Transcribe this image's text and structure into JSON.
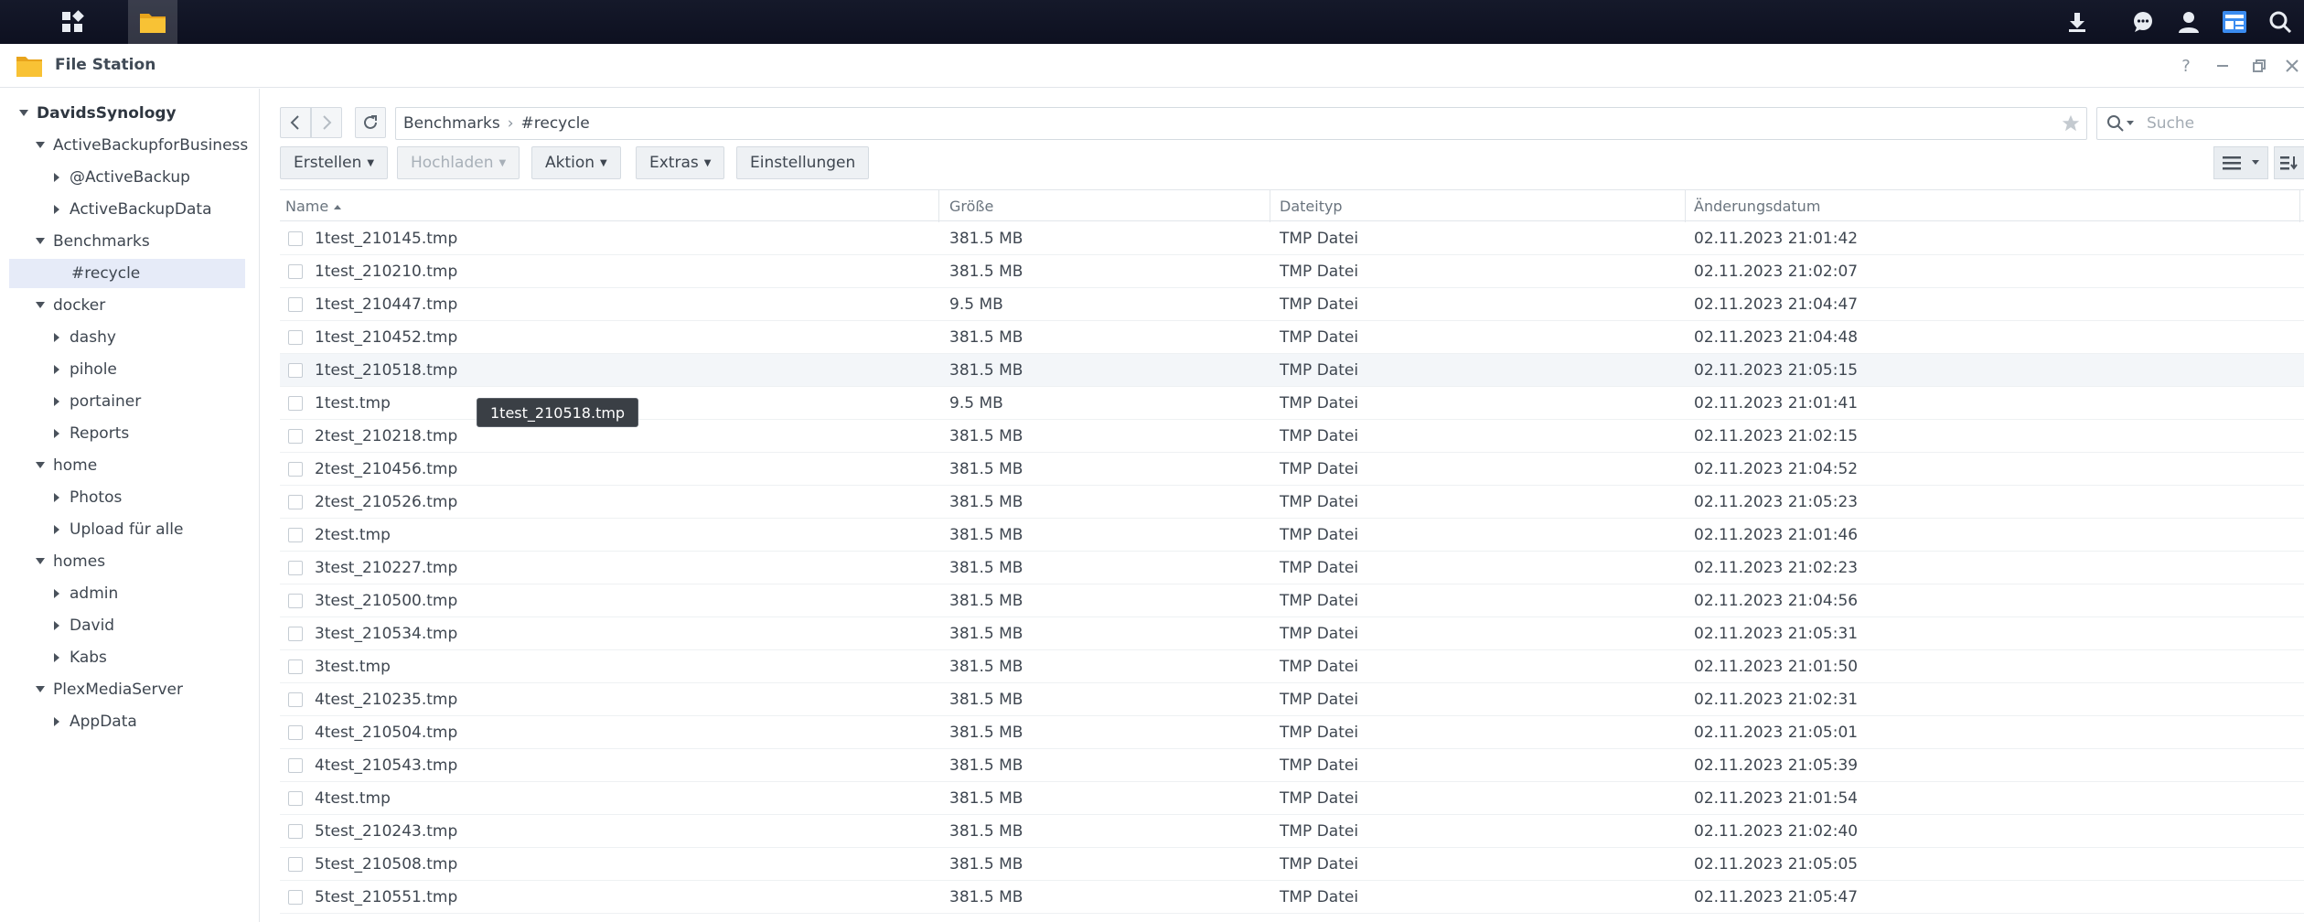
{
  "window": {
    "title": "File Station"
  },
  "sidebar": {
    "root": "DavidsSynology",
    "items": [
      {
        "label": "ActiveBackupforBusiness",
        "level": 1,
        "expanded": true
      },
      {
        "label": "@ActiveBackup",
        "level": 2,
        "expanded": false
      },
      {
        "label": "ActiveBackupData",
        "level": 2,
        "expanded": false
      },
      {
        "label": "Benchmarks",
        "level": 1,
        "expanded": true
      },
      {
        "label": "#recycle",
        "level": 2,
        "selected": true
      },
      {
        "label": "docker",
        "level": 1,
        "expanded": true
      },
      {
        "label": "dashy",
        "level": 2,
        "expanded": false
      },
      {
        "label": "pihole",
        "level": 2,
        "expanded": false
      },
      {
        "label": "portainer",
        "level": 2,
        "expanded": false
      },
      {
        "label": "Reports",
        "level": 2,
        "expanded": false
      },
      {
        "label": "home",
        "level": 1,
        "expanded": true
      },
      {
        "label": "Photos",
        "level": 2,
        "expanded": false
      },
      {
        "label": "Upload für alle",
        "level": 2,
        "expanded": false
      },
      {
        "label": "homes",
        "level": 1,
        "expanded": true
      },
      {
        "label": "admin",
        "level": 2,
        "expanded": false
      },
      {
        "label": "David",
        "level": 2,
        "expanded": false
      },
      {
        "label": "Kabs",
        "level": 2,
        "expanded": false
      },
      {
        "label": "PlexMediaServer",
        "level": 1,
        "expanded": true
      },
      {
        "label": "AppData",
        "level": 2,
        "expanded": false
      }
    ]
  },
  "path": {
    "segments": [
      "Benchmarks",
      "#recycle"
    ]
  },
  "search": {
    "placeholder": "Suche"
  },
  "toolbar": {
    "create": "Erstellen",
    "upload": "Hochladen",
    "action": "Aktion",
    "extras": "Extras",
    "settings": "Einstellungen"
  },
  "table": {
    "columns": {
      "name": "Name",
      "size": "Größe",
      "type": "Dateityp",
      "modified": "Änderungsdatum"
    },
    "rows": [
      {
        "name": "1test_210145.tmp",
        "size": "381.5 MB",
        "type": "TMP Datei",
        "modified": "02.11.2023 21:01:42"
      },
      {
        "name": "1test_210210.tmp",
        "size": "381.5 MB",
        "type": "TMP Datei",
        "modified": "02.11.2023 21:02:07"
      },
      {
        "name": "1test_210447.tmp",
        "size": "9.5 MB",
        "type": "TMP Datei",
        "modified": "02.11.2023 21:04:47"
      },
      {
        "name": "1test_210452.tmp",
        "size": "381.5 MB",
        "type": "TMP Datei",
        "modified": "02.11.2023 21:04:48"
      },
      {
        "name": "1test_210518.tmp",
        "size": "381.5 MB",
        "type": "TMP Datei",
        "modified": "02.11.2023 21:05:15",
        "hover": true
      },
      {
        "name": "1test.tmp",
        "size": "9.5 MB",
        "type": "TMP Datei",
        "modified": "02.11.2023 21:01:41"
      },
      {
        "name": "2test_210218.tmp",
        "size": "381.5 MB",
        "type": "TMP Datei",
        "modified": "02.11.2023 21:02:15"
      },
      {
        "name": "2test_210456.tmp",
        "size": "381.5 MB",
        "type": "TMP Datei",
        "modified": "02.11.2023 21:04:52"
      },
      {
        "name": "2test_210526.tmp",
        "size": "381.5 MB",
        "type": "TMP Datei",
        "modified": "02.11.2023 21:05:23"
      },
      {
        "name": "2test.tmp",
        "size": "381.5 MB",
        "type": "TMP Datei",
        "modified": "02.11.2023 21:01:46"
      },
      {
        "name": "3test_210227.tmp",
        "size": "381.5 MB",
        "type": "TMP Datei",
        "modified": "02.11.2023 21:02:23"
      },
      {
        "name": "3test_210500.tmp",
        "size": "381.5 MB",
        "type": "TMP Datei",
        "modified": "02.11.2023 21:04:56"
      },
      {
        "name": "3test_210534.tmp",
        "size": "381.5 MB",
        "type": "TMP Datei",
        "modified": "02.11.2023 21:05:31"
      },
      {
        "name": "3test.tmp",
        "size": "381.5 MB",
        "type": "TMP Datei",
        "modified": "02.11.2023 21:01:50"
      },
      {
        "name": "4test_210235.tmp",
        "size": "381.5 MB",
        "type": "TMP Datei",
        "modified": "02.11.2023 21:02:31"
      },
      {
        "name": "4test_210504.tmp",
        "size": "381.5 MB",
        "type": "TMP Datei",
        "modified": "02.11.2023 21:05:01"
      },
      {
        "name": "4test_210543.tmp",
        "size": "381.5 MB",
        "type": "TMP Datei",
        "modified": "02.11.2023 21:05:39"
      },
      {
        "name": "4test.tmp",
        "size": "381.5 MB",
        "type": "TMP Datei",
        "modified": "02.11.2023 21:01:54"
      },
      {
        "name": "5test_210243.tmp",
        "size": "381.5 MB",
        "type": "TMP Datei",
        "modified": "02.11.2023 21:02:40"
      },
      {
        "name": "5test_210508.tmp",
        "size": "381.5 MB",
        "type": "TMP Datei",
        "modified": "02.11.2023 21:05:05"
      },
      {
        "name": "5test_210551.tmp",
        "size": "381.5 MB",
        "type": "TMP Datei",
        "modified": "02.11.2023 21:05:47"
      }
    ]
  },
  "tooltip": {
    "text": "1test_210518.tmp"
  },
  "colors": {
    "accent": "#2d6bd4",
    "selection": "#e6ebf8",
    "taskbar": "#111526"
  }
}
